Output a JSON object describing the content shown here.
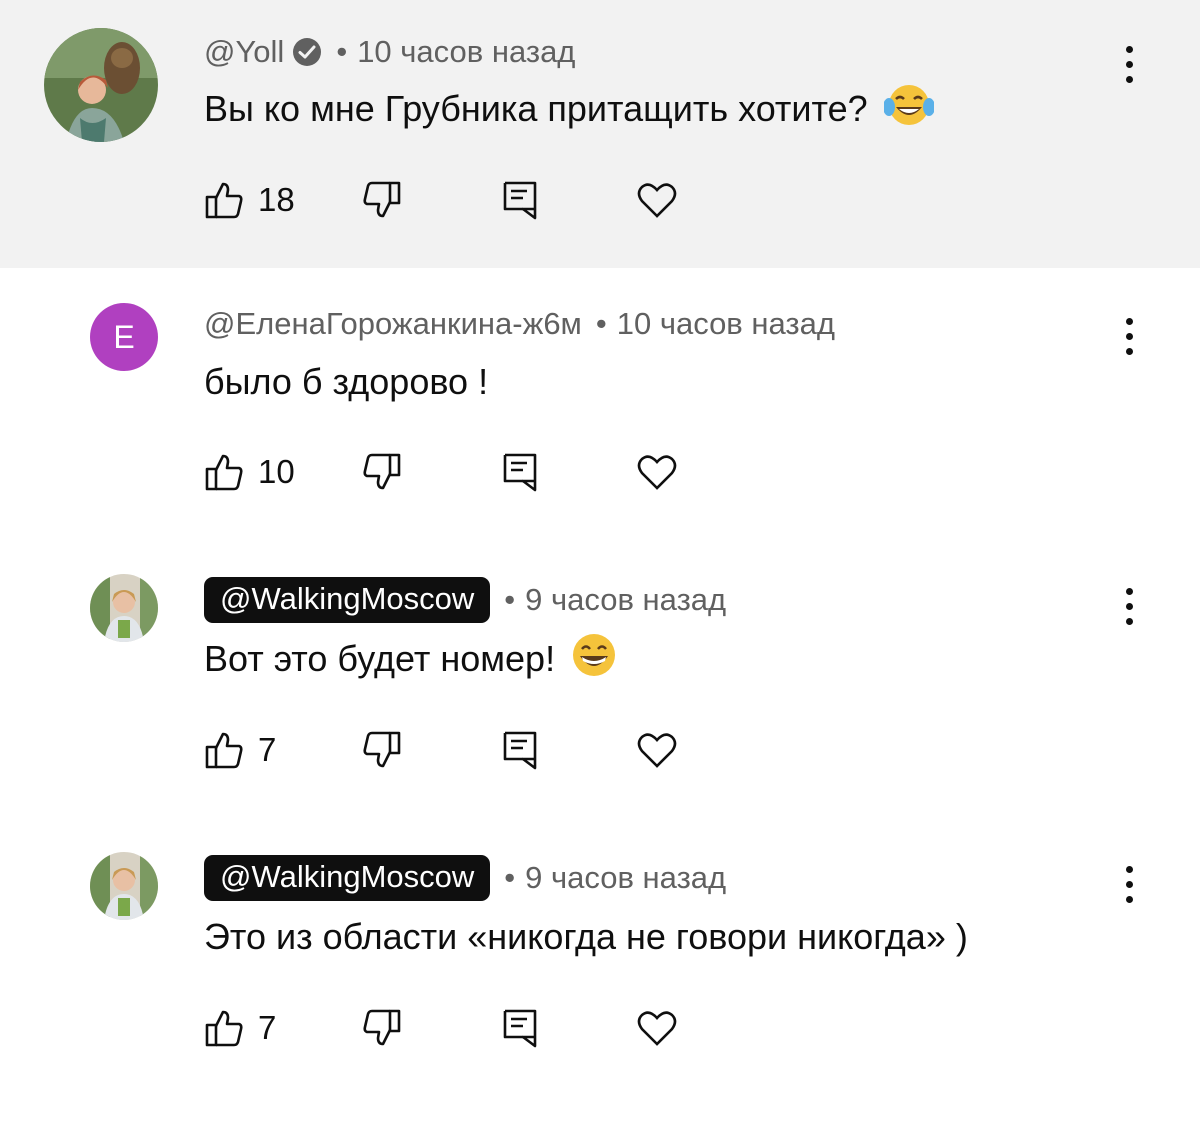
{
  "comments": [
    {
      "author": "@Yoll",
      "verified": true,
      "time": "10 часов назад",
      "text": "Вы ко мне Грубника притащить хотите?",
      "emoji": "😂",
      "likes": "18",
      "avatar": "photo"
    },
    {
      "author": "@ЕленаГорожанкина-ж6м",
      "verified": false,
      "time": "10 часов назад",
      "text": "было б здорово !",
      "likes": "10",
      "avatar": "letter",
      "avatar_letter": "E",
      "avatar_color": "#b040c0"
    },
    {
      "author": "@WalkingMoscow",
      "highlighted": true,
      "time": "9 часов назад",
      "text": "Вот это будет номер!",
      "emoji": "😁",
      "likes": "7",
      "avatar": "photo"
    },
    {
      "author": "@WalkingMoscow",
      "highlighted": true,
      "time": "9 часов назад",
      "text": "Это из области «никогда не говори никогда» )",
      "likes": "7",
      "avatar": "photo"
    }
  ],
  "icons": {
    "like": "thumb-up-icon",
    "dislike": "thumb-down-icon",
    "reply": "reply-icon",
    "heart": "heart-icon",
    "more": "more-vert-icon",
    "verified": "verified-check-icon"
  }
}
